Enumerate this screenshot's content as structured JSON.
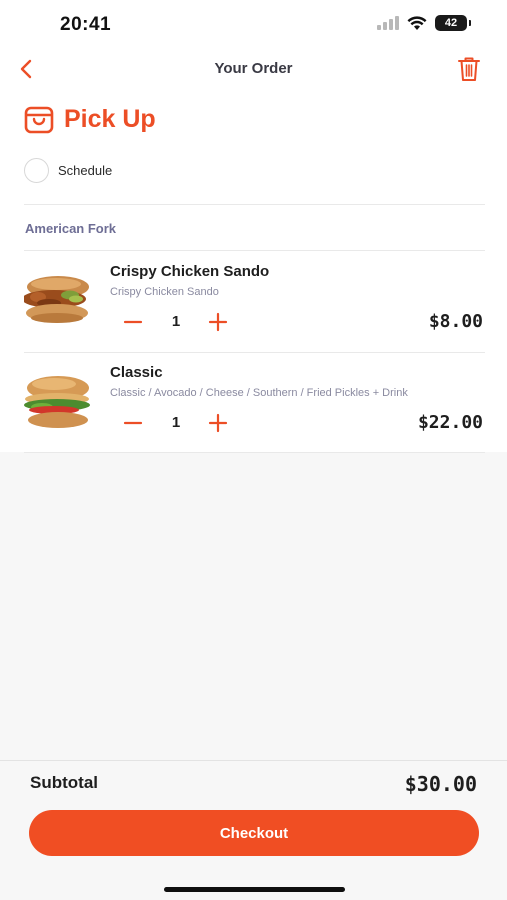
{
  "status_bar": {
    "time": "20:41",
    "battery": "42"
  },
  "nav": {
    "title": "Your Order",
    "back_icon": "chevron-left-icon",
    "trash_icon": "trash-icon"
  },
  "order_type": {
    "label": "Pick Up",
    "icon": "shopping-bag-icon"
  },
  "schedule": {
    "label": "Schedule",
    "checked": false
  },
  "location": "American Fork",
  "items": [
    {
      "name": "Crispy Chicken Sando",
      "description": "Crispy Chicken Sando",
      "quantity": "1",
      "price": "$8.00"
    },
    {
      "name": "Classic",
      "description": "Classic / Avocado / Cheese / Southern / Fried Pickles + Drink",
      "quantity": "1",
      "price": "$22.00"
    }
  ],
  "summary": {
    "subtotal_label": "Subtotal",
    "subtotal_value": "$30.00"
  },
  "checkout_label": "Checkout",
  "colors": {
    "accent": "#f04e23",
    "muted_text": "#8a8aa0",
    "location_text": "#6e6e95"
  }
}
